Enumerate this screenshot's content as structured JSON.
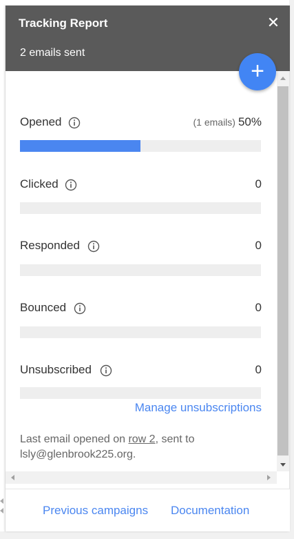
{
  "header": {
    "title": "Tracking Report",
    "close_label": "✕",
    "subtitle": "2 emails sent"
  },
  "fab": {
    "label": "+"
  },
  "metrics": [
    {
      "label": "Opened",
      "detail": "(1 emails)",
      "value": "50%",
      "fraction": 0.5
    },
    {
      "label": "Clicked",
      "detail": "",
      "value": "0",
      "fraction": 0
    },
    {
      "label": "Responded",
      "detail": "",
      "value": "0",
      "fraction": 0
    },
    {
      "label": "Bounced",
      "detail": "",
      "value": "0",
      "fraction": 0
    },
    {
      "label": "Unsubscribed",
      "detail": "",
      "value": "0",
      "fraction": 0
    }
  ],
  "manage_link": "Manage unsubscriptions",
  "last_opened": {
    "prefix": "Last email opened on ",
    "row_link": "row 2",
    "suffix": ", sent to lsly@glenbrook225.org."
  },
  "footer": {
    "previous_campaigns": "Previous campaigns",
    "documentation": "Documentation"
  },
  "colors": {
    "header_bg": "#5a5a5a",
    "accent": "#4285f4",
    "bar_fill": "#4a86f0",
    "bar_track": "#eeeeee"
  },
  "icons": {
    "close": "close-icon",
    "add": "plus-icon",
    "info": "info-icon"
  }
}
